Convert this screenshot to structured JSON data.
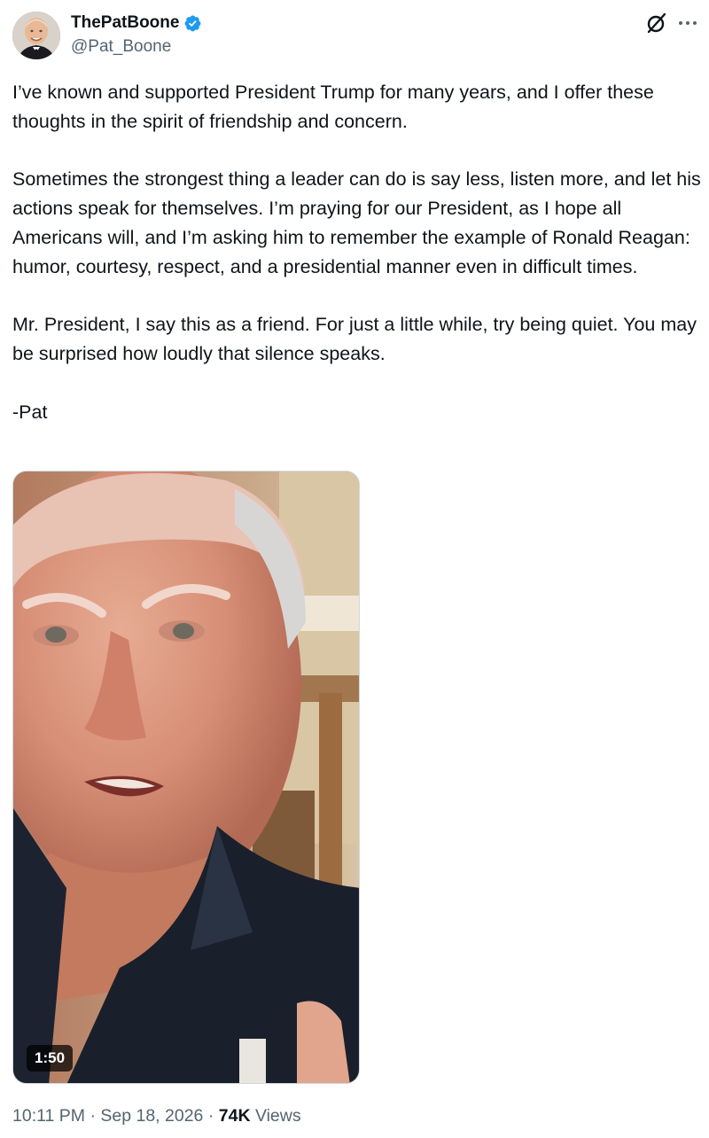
{
  "author": {
    "display_name": "ThePatBoone",
    "handle": "@Pat_Boone",
    "verified_color": "#1d9bf0"
  },
  "tweet": {
    "paragraphs": [
      "I’ve known and supported President Trump for many years, and I offer these thoughts in the spirit of friendship and concern.",
      "Sometimes the strongest thing a leader can do is say less, listen more, and let his actions speak for themselves. I’m praying for our President, as I hope all Americans will, and I’m asking him to remember the example of Ronald Reagan: humor, courtesy, respect, and a presidential manner even in difficult times.",
      "Mr. President, I say this as a friend. For just a little while, try being quiet. You may be surprised how loudly that silence speaks.",
      "-Pat"
    ]
  },
  "media": {
    "type": "video",
    "duration": "1:50"
  },
  "meta": {
    "time": "10:11 PM",
    "separator1": " · ",
    "date": "Sep 18, 2026",
    "separator2": " · ",
    "views_count": "74K",
    "views_label": " Views"
  },
  "icons": {
    "verified": "verified-badge-icon",
    "grok": "grok-icon",
    "more": "more-options-icon"
  }
}
